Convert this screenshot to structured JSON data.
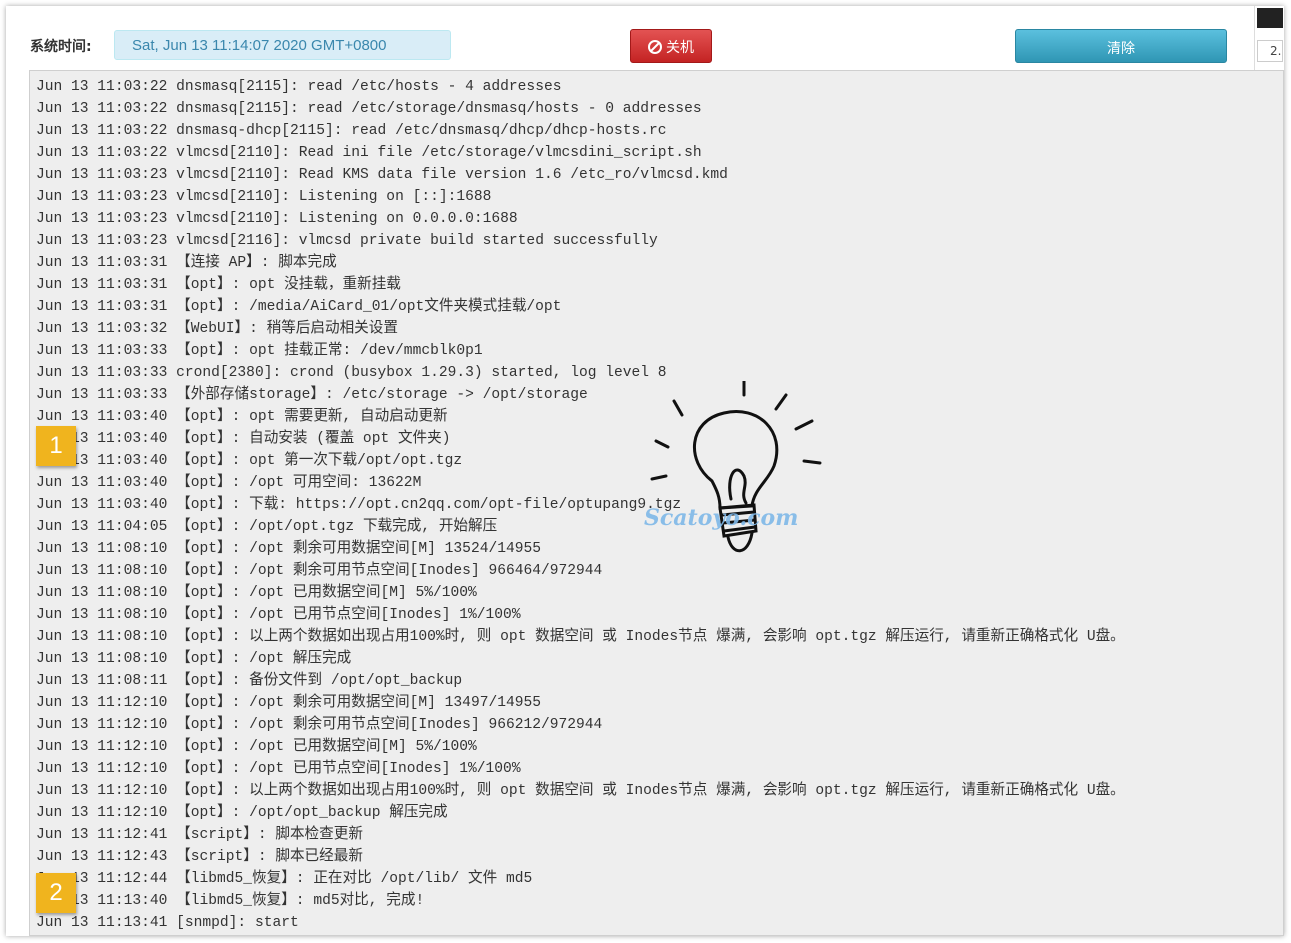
{
  "toolbar": {
    "system_time_label": "系统时间:",
    "system_time_value": "Sat, Jun 13 11:14:07 2020 GMT+0800",
    "shutdown_label": "关机",
    "clear_label": "清除",
    "edge_text": "2."
  },
  "badges": [
    "1",
    "2"
  ],
  "watermark_text": "Scatoyo.com",
  "log_lines": [
    "Jun 13 11:03:22 dnsmasq[2115]: read /etc/hosts - 4 addresses",
    "Jun 13 11:03:22 dnsmasq[2115]: read /etc/storage/dnsmasq/hosts - 0 addresses",
    "Jun 13 11:03:22 dnsmasq-dhcp[2115]: read /etc/dnsmasq/dhcp/dhcp-hosts.rc",
    "Jun 13 11:03:22 vlmcsd[2110]: Read ini file /etc/storage/vlmcsdini_script.sh",
    "Jun 13 11:03:23 vlmcsd[2110]: Read KMS data file version 1.6 /etc_ro/vlmcsd.kmd",
    "Jun 13 11:03:23 vlmcsd[2110]: Listening on [::]:1688",
    "Jun 13 11:03:23 vlmcsd[2110]: Listening on 0.0.0.0:1688",
    "Jun 13 11:03:23 vlmcsd[2116]: vlmcsd private build started successfully",
    "Jun 13 11:03:31 【连接 AP】: 脚本完成",
    "Jun 13 11:03:31 【opt】: opt 没挂载，重新挂载",
    "Jun 13 11:03:31 【opt】: /media/AiCard_01/opt文件夹模式挂载/opt",
    "Jun 13 11:03:32 【WebUI】: 稍等后启动相关设置",
    "Jun 13 11:03:33 【opt】: opt 挂载正常: /dev/mmcblk0p1",
    "Jun 13 11:03:33 crond[2380]: crond (busybox 1.29.3) started, log level 8",
    "Jun 13 11:03:33 【外部存储storage】: /etc/storage -> /opt/storage",
    "Jun 13 11:03:40 【opt】: opt 需要更新, 自动启动更新",
    "Jun 13 11:03:40 【opt】: 自动安装 (覆盖 opt 文件夹)",
    "Jun 13 11:03:40 【opt】: opt 第一次下载/opt/opt.tgz",
    "Jun 13 11:03:40 【opt】: /opt 可用空间: 13622M",
    "Jun 13 11:03:40 【opt】: 下载: https://opt.cn2qq.com/opt-file/optupang9.tgz",
    "Jun 13 11:04:05 【opt】: /opt/opt.tgz 下载完成, 开始解压",
    "Jun 13 11:08:10 【opt】: /opt 剩余可用数据空间[M] 13524/14955",
    "Jun 13 11:08:10 【opt】: /opt 剩余可用节点空间[Inodes] 966464/972944",
    "Jun 13 11:08:10 【opt】: /opt 已用数据空间[M] 5%/100%",
    "Jun 13 11:08:10 【opt】: /opt 已用节点空间[Inodes] 1%/100%",
    "Jun 13 11:08:10 【opt】: 以上两个数据如出现占用100%时, 则 opt 数据空间 或 Inodes节点 爆满, 会影响 opt.tgz 解压运行, 请重新正确格式化 U盘。",
    "Jun 13 11:08:10 【opt】: /opt 解压完成",
    "Jun 13 11:08:11 【opt】: 备份文件到 /opt/opt_backup",
    "Jun 13 11:12:10 【opt】: /opt 剩余可用数据空间[M] 13497/14955",
    "Jun 13 11:12:10 【opt】: /opt 剩余可用节点空间[Inodes] 966212/972944",
    "Jun 13 11:12:10 【opt】: /opt 已用数据空间[M] 5%/100%",
    "Jun 13 11:12:10 【opt】: /opt 已用节点空间[Inodes] 1%/100%",
    "Jun 13 11:12:10 【opt】: 以上两个数据如出现占用100%时, 则 opt 数据空间 或 Inodes节点 爆满, 会影响 opt.tgz 解压运行, 请重新正确格式化 U盘。",
    "Jun 13 11:12:10 【opt】: /opt/opt_backup 解压完成",
    "Jun 13 11:12:41 【script】: 脚本检查更新",
    "Jun 13 11:12:43 【script】: 脚本已经最新",
    "Jun 13 11:12:44 【libmd5_恢复】: 正在对比 /opt/lib/ 文件 md5",
    "Jun 13 11:13:40 【libmd5_恢复】: md5对比, 完成!",
    "Jun 13 11:13:41 [snmpd]: start"
  ]
}
